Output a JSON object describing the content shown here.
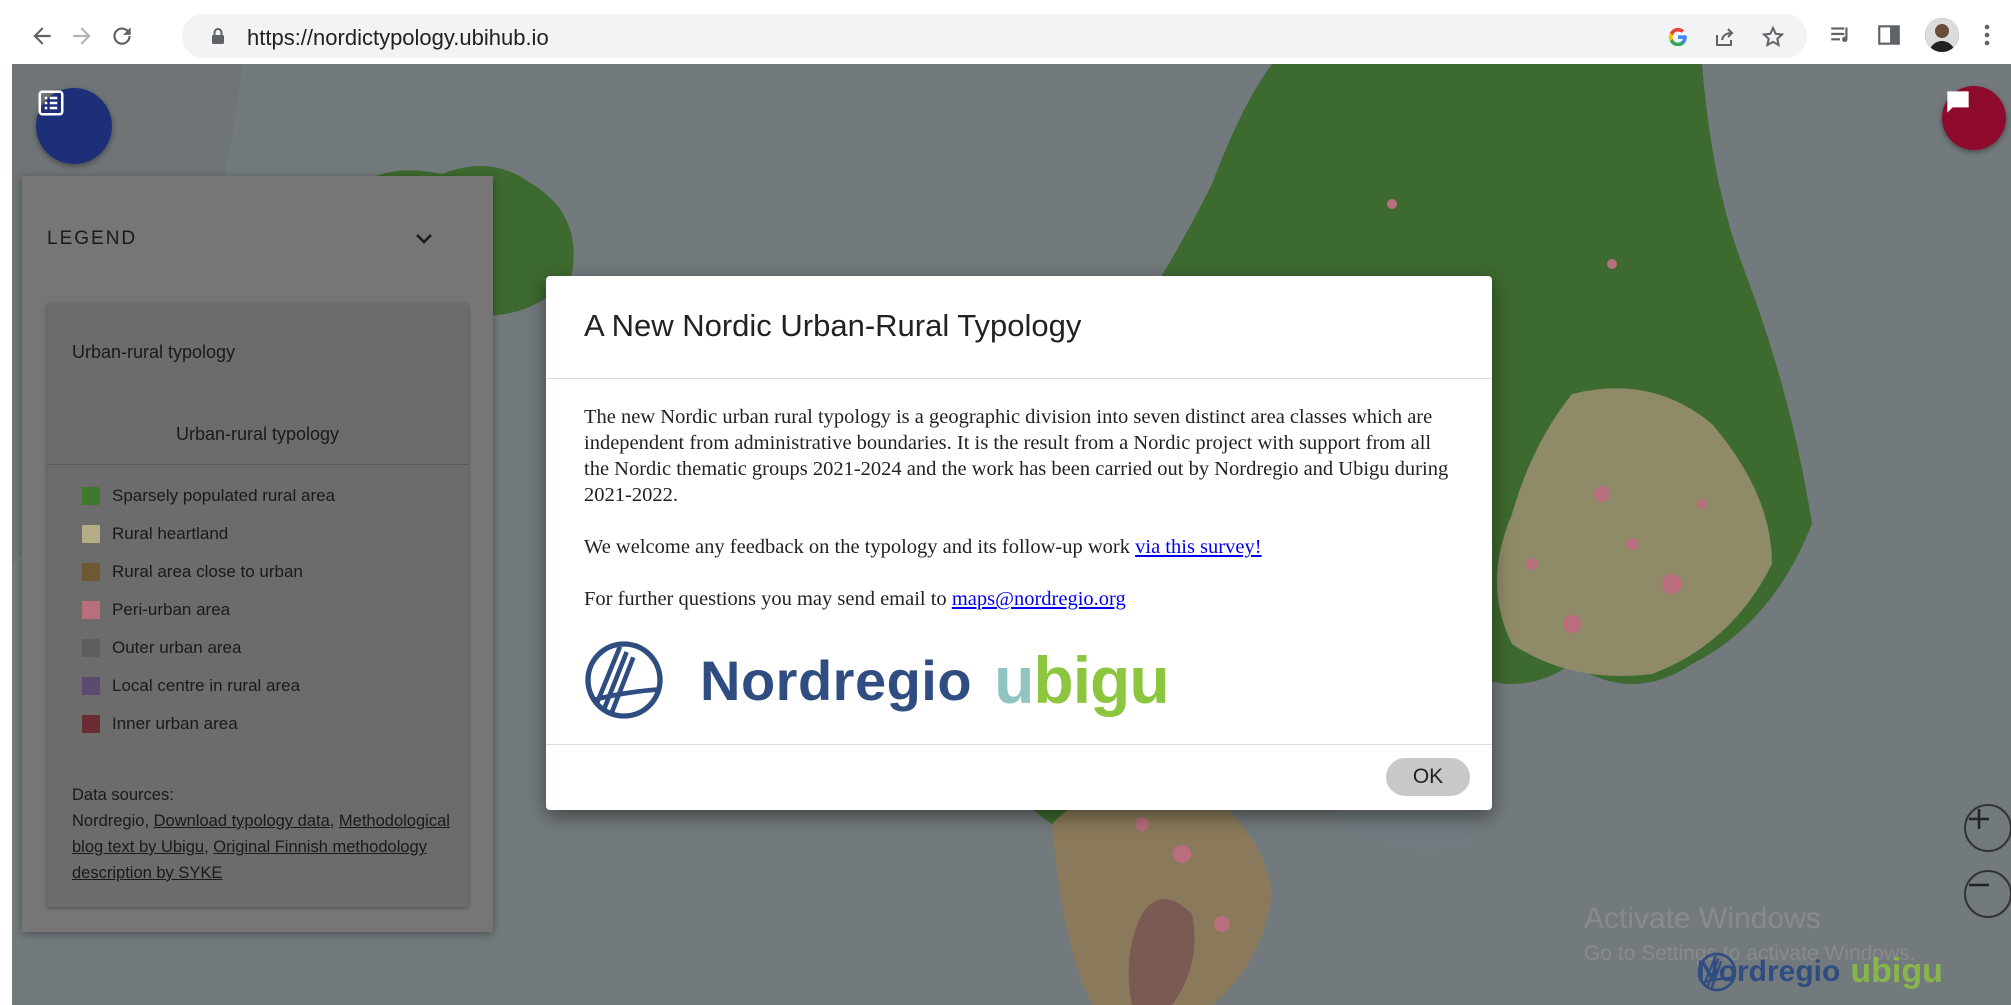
{
  "browser": {
    "url": "https://nordictypology.ubihub.io",
    "icons": [
      "back-icon",
      "forward-icon",
      "reload-icon",
      "lock-icon",
      "google-icon",
      "share-icon",
      "bookmark-star-icon",
      "media-icon",
      "side-panel-icon",
      "profile-avatar",
      "more-icon"
    ]
  },
  "legend": {
    "title": "LEGEND",
    "card_title": "Urban-rural typology",
    "card_subtitle": "Urban-rural typology",
    "items": [
      {
        "label": "Sparsely populated rural area",
        "color": "#3e7a2d"
      },
      {
        "label": "Rural heartland",
        "color": "#b4ad85"
      },
      {
        "label": "Rural area close to urban",
        "color": "#6d5a35"
      },
      {
        "label": "Peri-urban area",
        "color": "#b86e7c"
      },
      {
        "label": "Outer urban area",
        "color": "#5e5e5e"
      },
      {
        "label": "Local centre in rural area",
        "color": "#5d4a72"
      },
      {
        "label": "Inner urban area",
        "color": "#6a2c33"
      }
    ],
    "sources_label": "Data sources:",
    "sources_prefix": "Nordregio, ",
    "link_download": "Download typology data",
    "link_blog": "Methodological blog text by Ubigu",
    "link_syke": "Original Finnish methodology description by SYKE",
    "sep": ", "
  },
  "modal": {
    "title": "A New Nordic Urban-Rural Typology",
    "para1": "The new Nordic urban rural typology is a geographic division into seven distinct area classes which are independent from administrative boundaries. It is the result from a Nordic project with support from all the Nordic thematic groups 2021-2024 and the work has been carried out by Nordregio and Ubigu during 2021-2022.",
    "para2_text": "We welcome any feedback on the typology and its follow-up work ",
    "para2_link": "via this survey!",
    "para3_text": "For further questions you may send email to ",
    "para3_link": "maps@nordregio.org",
    "logo_nordregio": "Nordregio",
    "logo_ubigu": "ubigu",
    "ok_label": "OK"
  },
  "footer": {
    "nordregio": "Nordregio",
    "ubigu": "ubigu"
  },
  "watermark": {
    "line1": "Activate Windows",
    "line2": "Go to Settings to activate Windows."
  },
  "colors": {
    "fab_list": "#1e2f7a",
    "fab_chat": "#8e0b2e",
    "link": "#0000ee",
    "nordregio_blue": "#2f4d80",
    "ubigu_green": "#8cc63f",
    "ubigu_teal": "#8fc4c0"
  }
}
